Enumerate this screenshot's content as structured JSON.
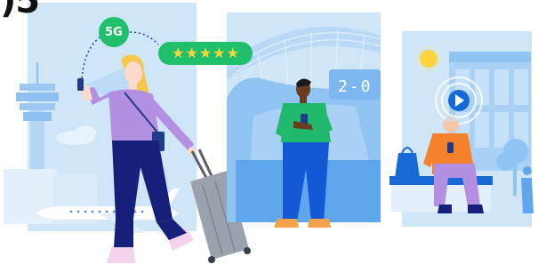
{
  "heading_fragment": ")5",
  "badge_5g": "5G",
  "rating": {
    "value": 5,
    "max": 5,
    "glyph": "★"
  },
  "scoreboard": "2-0",
  "colors": {
    "panel_light": "#cfe5f8",
    "panel_mid": "#7fbaf2",
    "accent_green": "#1fbf6b",
    "star_yellow": "#ffd43a",
    "brand_blue": "#1769d6"
  },
  "icons": [
    "5g-signal-icon",
    "star-icon",
    "play-icon",
    "sun-icon",
    "phone-icon"
  ]
}
